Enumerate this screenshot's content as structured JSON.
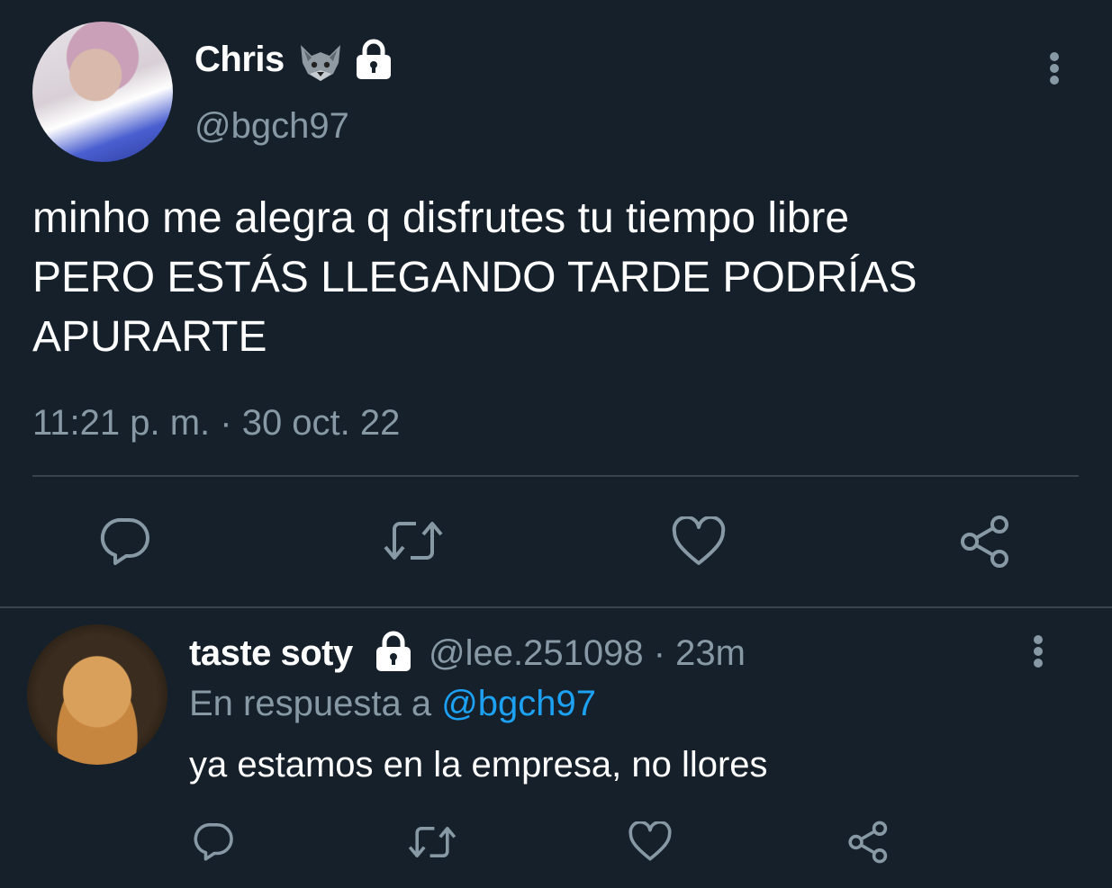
{
  "tweet": {
    "author_name": "Chris",
    "author_emoji": "wolf-icon",
    "protected": "lock-icon",
    "handle": "@bgch97",
    "text": "minho me alegra q disfrutes tu tiempo libre\nPERO ESTÁS LLEGANDO TARDE PODRÍAS\nAPURARTE",
    "timestamp": "11:21 p. m. · 30 oct. 22",
    "actions": [
      "reply-icon",
      "retweet-icon",
      "like-icon",
      "share-icon"
    ]
  },
  "reply": {
    "author_name": "taste soty",
    "protected": "lock-icon",
    "handle_time": "@lee.251098 · 23m",
    "in_reply_prefix": "En respuesta a ",
    "in_reply_handle": "@bgch97",
    "text": "ya estamos en la empresa, no llores",
    "actions": [
      "reply-icon",
      "retweet-icon",
      "like-icon",
      "share-icon"
    ]
  },
  "colors": {
    "background": "#15202b",
    "text": "#ffffff",
    "muted": "#8899a6",
    "link": "#1da1f2",
    "divider": "#38444d"
  }
}
